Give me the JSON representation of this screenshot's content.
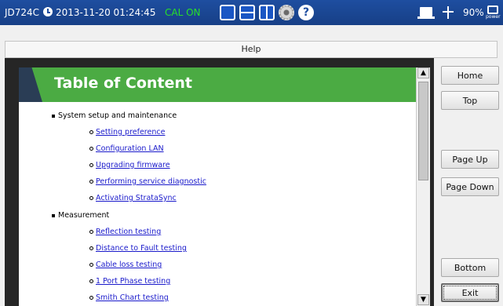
{
  "status_bar": {
    "model": "JD724C",
    "datetime": "2013-11-20 01:24:45",
    "cal_status": "CAL ON",
    "battery": "90%",
    "power_label": "power",
    "icons": [
      "clock-icon",
      "single-view-icon",
      "split-horizontal-icon",
      "split-vertical-icon",
      "gear-icon",
      "help-icon",
      "monitor-icon",
      "usb-icon",
      "power-icon"
    ],
    "help_glyph": "?"
  },
  "help_bar": {
    "title": "Help"
  },
  "content": {
    "title": "Table of Content",
    "sections": [
      {
        "label": "System setup and maintenance",
        "links": [
          "Setting preference",
          "Configuration LAN",
          "Upgrading firmware",
          "Performing service diagnostic",
          "Activating StrataSync"
        ]
      },
      {
        "label": "Measurement",
        "links": [
          "Reflection testing",
          "Distance to Fault testing",
          "Cable loss testing",
          "1 Port Phase testing",
          "Smith Chart testing"
        ]
      }
    ]
  },
  "scrollbar": {
    "up": "▲",
    "down": "▼"
  },
  "nav_buttons": {
    "home": "Home",
    "top": "Top",
    "page_up": "Page Up",
    "page_down": "Page Down",
    "bottom": "Bottom",
    "exit": "Exit"
  },
  "colors": {
    "status_bar": "#1e4ea0",
    "cal_on": "#28e028",
    "banner": "#4bab43",
    "link": "#1a1acb"
  }
}
